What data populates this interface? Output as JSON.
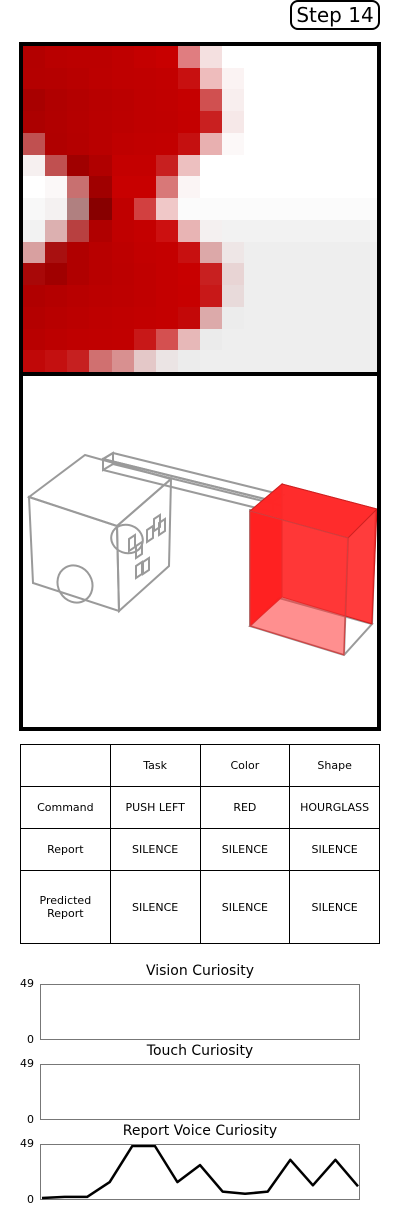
{
  "step_label": "Step 14",
  "vision_pixels": {
    "rows": 15,
    "cols": 16,
    "colors": [
      [
        "#b30000",
        "#b90000",
        "#bb0000",
        "#bb0000",
        "#bf0000",
        "#c40000",
        "#c80000",
        "#e07d80",
        "#f4e0e0",
        "#ffffff",
        "#ffffff",
        "#ffffff",
        "#ffffff",
        "#ffffff",
        "#ffffff",
        "#ffffff"
      ],
      [
        "#b40000",
        "#b50000",
        "#b80000",
        "#bc0000",
        "#bf0000",
        "#c00000",
        "#c20000",
        "#c81010",
        "#eebcbc",
        "#fbf3f3",
        "#ffffff",
        "#ffffff",
        "#ffffff",
        "#ffffff",
        "#ffffff",
        "#ffffff"
      ],
      [
        "#a80000",
        "#b00000",
        "#b40000",
        "#b80000",
        "#bb0000",
        "#bf0000",
        "#c10000",
        "#c50000",
        "#d05050",
        "#f8eeee",
        "#ffffff",
        "#ffffff",
        "#ffffff",
        "#ffffff",
        "#ffffff",
        "#ffffff"
      ],
      [
        "#ac0000",
        "#b10000",
        "#b50000",
        "#b90000",
        "#bc0000",
        "#bf0000",
        "#c00000",
        "#c40000",
        "#c92020",
        "#f6e8e8",
        "#ffffff",
        "#ffffff",
        "#ffffff",
        "#ffffff",
        "#ffffff",
        "#ffffff"
      ],
      [
        "#c05050",
        "#b00000",
        "#b40000",
        "#b90000",
        "#bf0000",
        "#c10000",
        "#c20000",
        "#c51010",
        "#e8b0b0",
        "#fcf8f8",
        "#ffffff",
        "#ffffff",
        "#ffffff",
        "#ffffff",
        "#ffffff",
        "#ffffff"
      ],
      [
        "#f6f0f0",
        "#c05050",
        "#a00000",
        "#b00000",
        "#c40000",
        "#c40000",
        "#c82020",
        "#edc0c0",
        "#ffffff",
        "#ffffff",
        "#ffffff",
        "#ffffff",
        "#ffffff",
        "#ffffff",
        "#ffffff",
        "#ffffff"
      ],
      [
        "#ffffff",
        "#fbf8f8",
        "#c87070",
        "#a00000",
        "#c80000",
        "#c80000",
        "#d87878",
        "#fbf5f5",
        "#ffffff",
        "#ffffff",
        "#ffffff",
        "#ffffff",
        "#ffffff",
        "#ffffff",
        "#ffffff",
        "#ffffff"
      ],
      [
        "#f8f8f8",
        "#f4f1f1",
        "#b08080",
        "#880000",
        "#c00000",
        "#d24040",
        "#f0c8c8",
        "#fbfbfb",
        "#fbfbfb",
        "#fbfbfb",
        "#fbfbfb",
        "#fbfbfb",
        "#fbfbfb",
        "#fbfbfb",
        "#fbfbfb",
        "#fbfbfb"
      ],
      [
        "#f2f2f2",
        "#dcb0b0",
        "#b84040",
        "#b00000",
        "#c00000",
        "#c40000",
        "#cc1010",
        "#e8b4b4",
        "#f4f0f0",
        "#f2f2f2",
        "#f2f2f2",
        "#f2f2f2",
        "#f2f2f2",
        "#f2f2f2",
        "#f2f2f2",
        "#f2f2f2"
      ],
      [
        "#d8a0a0",
        "#a81010",
        "#b00000",
        "#b80000",
        "#bd0000",
        "#c20000",
        "#c40000",
        "#c81010",
        "#dca8a8",
        "#eee6e6",
        "#eeeeee",
        "#eeeeee",
        "#eeeeee",
        "#eeeeee",
        "#eeeeee",
        "#eeeeee"
      ],
      [
        "#a80808",
        "#a00000",
        "#b00000",
        "#b80000",
        "#bc0000",
        "#c00000",
        "#c40000",
        "#c80000",
        "#c82020",
        "#e8d4d4",
        "#eeeeee",
        "#eeeeee",
        "#eeeeee",
        "#eeeeee",
        "#eeeeee",
        "#eeeeee"
      ],
      [
        "#b00000",
        "#b40000",
        "#b80000",
        "#bb0000",
        "#bd0000",
        "#c00000",
        "#c40000",
        "#c70000",
        "#c81818",
        "#e8dada",
        "#eeeeee",
        "#eeeeee",
        "#eeeeee",
        "#eeeeee",
        "#eeeeee",
        "#eeeeee"
      ],
      [
        "#b40000",
        "#b80000",
        "#bb0000",
        "#be0000",
        "#c00000",
        "#c20000",
        "#c40000",
        "#c30808",
        "#dcaaaa",
        "#ececec",
        "#eeeeee",
        "#eeeeee",
        "#eeeeee",
        "#eeeeee",
        "#eeeeee",
        "#eeeeee"
      ],
      [
        "#b80000",
        "#bc0000",
        "#bf0000",
        "#c00000",
        "#c10000",
        "#c81818",
        "#d45050",
        "#e7b8b8",
        "#ebebeb",
        "#eeeeee",
        "#eeeeee",
        "#eeeeee",
        "#eeeeee",
        "#eeeeee",
        "#eeeeee",
        "#eeeeee"
      ],
      [
        "#c00808",
        "#c41010",
        "#c62020",
        "#d07070",
        "#d89090",
        "#e4c8c8",
        "#ebe4e4",
        "#ececec",
        "#eeeeee",
        "#eeeeee",
        "#eeeeee",
        "#eeeeee",
        "#eeeeee",
        "#eeeeee",
        "#eeeeee",
        "#eeeeee"
      ]
    ]
  },
  "scene": {
    "target_object_color": "#ff0000",
    "wireframe_color": "#999999"
  },
  "comm_table": {
    "headers": [
      "",
      "Task",
      "Color",
      "Shape"
    ],
    "rows": [
      {
        "label": "Command",
        "task": "PUSH LEFT",
        "color": "RED",
        "shape": "HOURGLASS"
      },
      {
        "label": "Report",
        "task": "SILENCE",
        "color": "SILENCE",
        "shape": "SILENCE"
      },
      {
        "label": "Predicted Report",
        "task": "SILENCE",
        "color": "SILENCE",
        "shape": "SILENCE"
      }
    ]
  },
  "curiosity_plots": [
    {
      "title": "Vision Curiosity",
      "y_max_label": "49",
      "y_min_label": "0",
      "ylim": [
        0,
        49
      ],
      "values": []
    },
    {
      "title": "Touch Curiosity",
      "y_max_label": "49",
      "y_min_label": "0",
      "ylim": [
        0,
        49
      ],
      "values": []
    },
    {
      "title": "Report Voice Curiosity",
      "y_max_label": "49",
      "y_min_label": "0",
      "ylim": [
        0,
        49
      ],
      "values": [
        0,
        1,
        1,
        15,
        49,
        49,
        15,
        31,
        6,
        4,
        6,
        36,
        12,
        36,
        11
      ]
    }
  ],
  "chart_data": [
    {
      "type": "line",
      "title": "Vision Curiosity",
      "ylim": [
        0,
        49
      ],
      "series": [
        {
          "values": []
        }
      ]
    },
    {
      "type": "line",
      "title": "Touch Curiosity",
      "ylim": [
        0,
        49
      ],
      "series": [
        {
          "values": []
        }
      ]
    },
    {
      "type": "line",
      "title": "Report Voice Curiosity",
      "ylim": [
        0,
        49
      ],
      "series": [
        {
          "values": [
            0,
            1,
            1,
            15,
            49,
            49,
            15,
            31,
            6,
            4,
            6,
            36,
            12,
            36,
            11
          ]
        }
      ]
    }
  ]
}
